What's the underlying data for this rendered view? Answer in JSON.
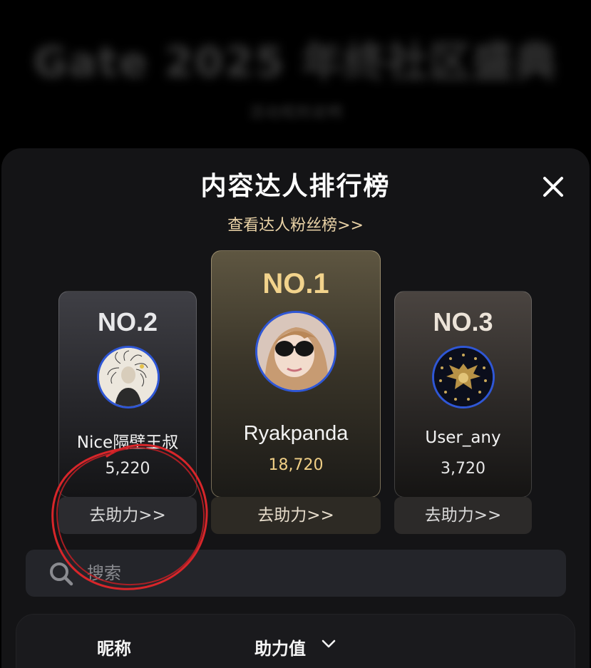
{
  "background": {
    "title": "Gate 2025 年终社区盛典",
    "subtitle": "活动规则说明"
  },
  "sheet": {
    "title": "内容达人排行榜",
    "fans_link": "查看达人粉丝榜>>",
    "close_icon": "close-icon"
  },
  "leaderboard": [
    {
      "rank": "NO.2",
      "name": "Nice隔壁王叔",
      "score": "5,220",
      "button": "去助力>>"
    },
    {
      "rank": "NO.1",
      "name": "Ryakpanda",
      "score": "18,720",
      "button": "去助力>>"
    },
    {
      "rank": "NO.3",
      "name": "User_any",
      "score": "3,720",
      "button": "去助力>>"
    }
  ],
  "search": {
    "placeholder": "搜索",
    "icon": "search-icon"
  },
  "table": {
    "col_nickname": "昵称",
    "col_help_value": "助力值",
    "sort_icon": "chevron-down-icon"
  },
  "colors": {
    "accent_gold": "#f2d38c",
    "annotation_red": "#d8262a",
    "avatar_ring": "#2f57d6"
  }
}
